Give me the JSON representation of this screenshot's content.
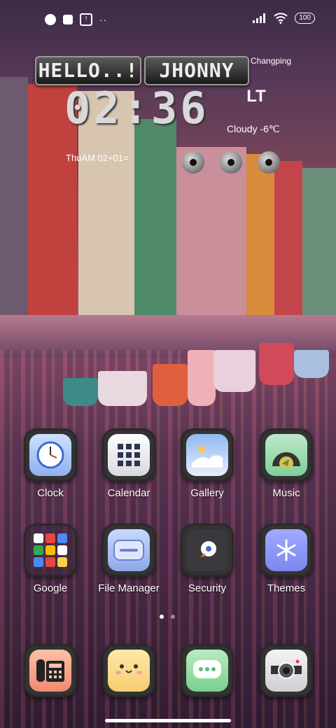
{
  "status": {
    "left_icons": [
      "notification-app-icon",
      "square-icon",
      "upload-icon",
      "more-dots-icon"
    ],
    "battery": "100",
    "right_icons": [
      "signal-icon",
      "wifi-icon",
      "battery-icon"
    ]
  },
  "widget": {
    "hello": "HELLO..!",
    "name": "JHONNY",
    "city": "Changping",
    "time": "02:36",
    "logo_text": "LT",
    "weather": "Cloudy -6℃",
    "date_line": "ThuAM 02+01="
  },
  "apps_row1": [
    {
      "label": "Clock",
      "icon": "clock-icon"
    },
    {
      "label": "Calendar",
      "icon": "calendar-icon"
    },
    {
      "label": "Gallery",
      "icon": "gallery-icon"
    },
    {
      "label": "Music",
      "icon": "music-icon"
    }
  ],
  "apps_row2": [
    {
      "label": "Google",
      "icon": "google-folder-icon"
    },
    {
      "label": "File Manager",
      "icon": "file-manager-icon"
    },
    {
      "label": "Security",
      "icon": "security-icon"
    },
    {
      "label": "Themes",
      "icon": "themes-icon"
    }
  ],
  "dock": [
    {
      "icon": "phone-icon"
    },
    {
      "icon": "messenger-face-icon"
    },
    {
      "icon": "messages-icon"
    },
    {
      "icon": "camera-icon"
    }
  ],
  "pager": {
    "pages": 2,
    "current": 1
  },
  "colors": {
    "accent": "#ffffff"
  }
}
